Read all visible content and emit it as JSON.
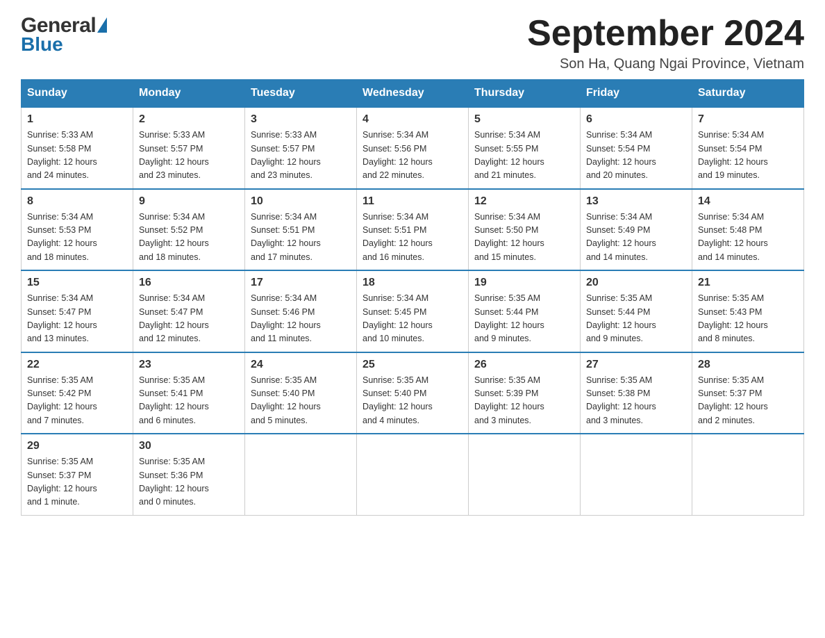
{
  "header": {
    "month_title": "September 2024",
    "location": "Son Ha, Quang Ngai Province, Vietnam",
    "logo_general": "General",
    "logo_blue": "Blue"
  },
  "days_of_week": [
    "Sunday",
    "Monday",
    "Tuesday",
    "Wednesday",
    "Thursday",
    "Friday",
    "Saturday"
  ],
  "weeks": [
    [
      {
        "day": "1",
        "sunrise": "5:33 AM",
        "sunset": "5:58 PM",
        "daylight": "12 hours and 24 minutes."
      },
      {
        "day": "2",
        "sunrise": "5:33 AM",
        "sunset": "5:57 PM",
        "daylight": "12 hours and 23 minutes."
      },
      {
        "day": "3",
        "sunrise": "5:33 AM",
        "sunset": "5:57 PM",
        "daylight": "12 hours and 23 minutes."
      },
      {
        "day": "4",
        "sunrise": "5:34 AM",
        "sunset": "5:56 PM",
        "daylight": "12 hours and 22 minutes."
      },
      {
        "day": "5",
        "sunrise": "5:34 AM",
        "sunset": "5:55 PM",
        "daylight": "12 hours and 21 minutes."
      },
      {
        "day": "6",
        "sunrise": "5:34 AM",
        "sunset": "5:54 PM",
        "daylight": "12 hours and 20 minutes."
      },
      {
        "day": "7",
        "sunrise": "5:34 AM",
        "sunset": "5:54 PM",
        "daylight": "12 hours and 19 minutes."
      }
    ],
    [
      {
        "day": "8",
        "sunrise": "5:34 AM",
        "sunset": "5:53 PM",
        "daylight": "12 hours and 18 minutes."
      },
      {
        "day": "9",
        "sunrise": "5:34 AM",
        "sunset": "5:52 PM",
        "daylight": "12 hours and 18 minutes."
      },
      {
        "day": "10",
        "sunrise": "5:34 AM",
        "sunset": "5:51 PM",
        "daylight": "12 hours and 17 minutes."
      },
      {
        "day": "11",
        "sunrise": "5:34 AM",
        "sunset": "5:51 PM",
        "daylight": "12 hours and 16 minutes."
      },
      {
        "day": "12",
        "sunrise": "5:34 AM",
        "sunset": "5:50 PM",
        "daylight": "12 hours and 15 minutes."
      },
      {
        "day": "13",
        "sunrise": "5:34 AM",
        "sunset": "5:49 PM",
        "daylight": "12 hours and 14 minutes."
      },
      {
        "day": "14",
        "sunrise": "5:34 AM",
        "sunset": "5:48 PM",
        "daylight": "12 hours and 14 minutes."
      }
    ],
    [
      {
        "day": "15",
        "sunrise": "5:34 AM",
        "sunset": "5:47 PM",
        "daylight": "12 hours and 13 minutes."
      },
      {
        "day": "16",
        "sunrise": "5:34 AM",
        "sunset": "5:47 PM",
        "daylight": "12 hours and 12 minutes."
      },
      {
        "day": "17",
        "sunrise": "5:34 AM",
        "sunset": "5:46 PM",
        "daylight": "12 hours and 11 minutes."
      },
      {
        "day": "18",
        "sunrise": "5:34 AM",
        "sunset": "5:45 PM",
        "daylight": "12 hours and 10 minutes."
      },
      {
        "day": "19",
        "sunrise": "5:35 AM",
        "sunset": "5:44 PM",
        "daylight": "12 hours and 9 minutes."
      },
      {
        "day": "20",
        "sunrise": "5:35 AM",
        "sunset": "5:44 PM",
        "daylight": "12 hours and 9 minutes."
      },
      {
        "day": "21",
        "sunrise": "5:35 AM",
        "sunset": "5:43 PM",
        "daylight": "12 hours and 8 minutes."
      }
    ],
    [
      {
        "day": "22",
        "sunrise": "5:35 AM",
        "sunset": "5:42 PM",
        "daylight": "12 hours and 7 minutes."
      },
      {
        "day": "23",
        "sunrise": "5:35 AM",
        "sunset": "5:41 PM",
        "daylight": "12 hours and 6 minutes."
      },
      {
        "day": "24",
        "sunrise": "5:35 AM",
        "sunset": "5:40 PM",
        "daylight": "12 hours and 5 minutes."
      },
      {
        "day": "25",
        "sunrise": "5:35 AM",
        "sunset": "5:40 PM",
        "daylight": "12 hours and 4 minutes."
      },
      {
        "day": "26",
        "sunrise": "5:35 AM",
        "sunset": "5:39 PM",
        "daylight": "12 hours and 3 minutes."
      },
      {
        "day": "27",
        "sunrise": "5:35 AM",
        "sunset": "5:38 PM",
        "daylight": "12 hours and 3 minutes."
      },
      {
        "day": "28",
        "sunrise": "5:35 AM",
        "sunset": "5:37 PM",
        "daylight": "12 hours and 2 minutes."
      }
    ],
    [
      {
        "day": "29",
        "sunrise": "5:35 AM",
        "sunset": "5:37 PM",
        "daylight": "12 hours and 1 minute."
      },
      {
        "day": "30",
        "sunrise": "5:35 AM",
        "sunset": "5:36 PM",
        "daylight": "12 hours and 0 minutes."
      },
      null,
      null,
      null,
      null,
      null
    ]
  ],
  "labels": {
    "sunrise_prefix": "Sunrise: ",
    "sunset_prefix": "Sunset: ",
    "daylight_prefix": "Daylight: "
  }
}
